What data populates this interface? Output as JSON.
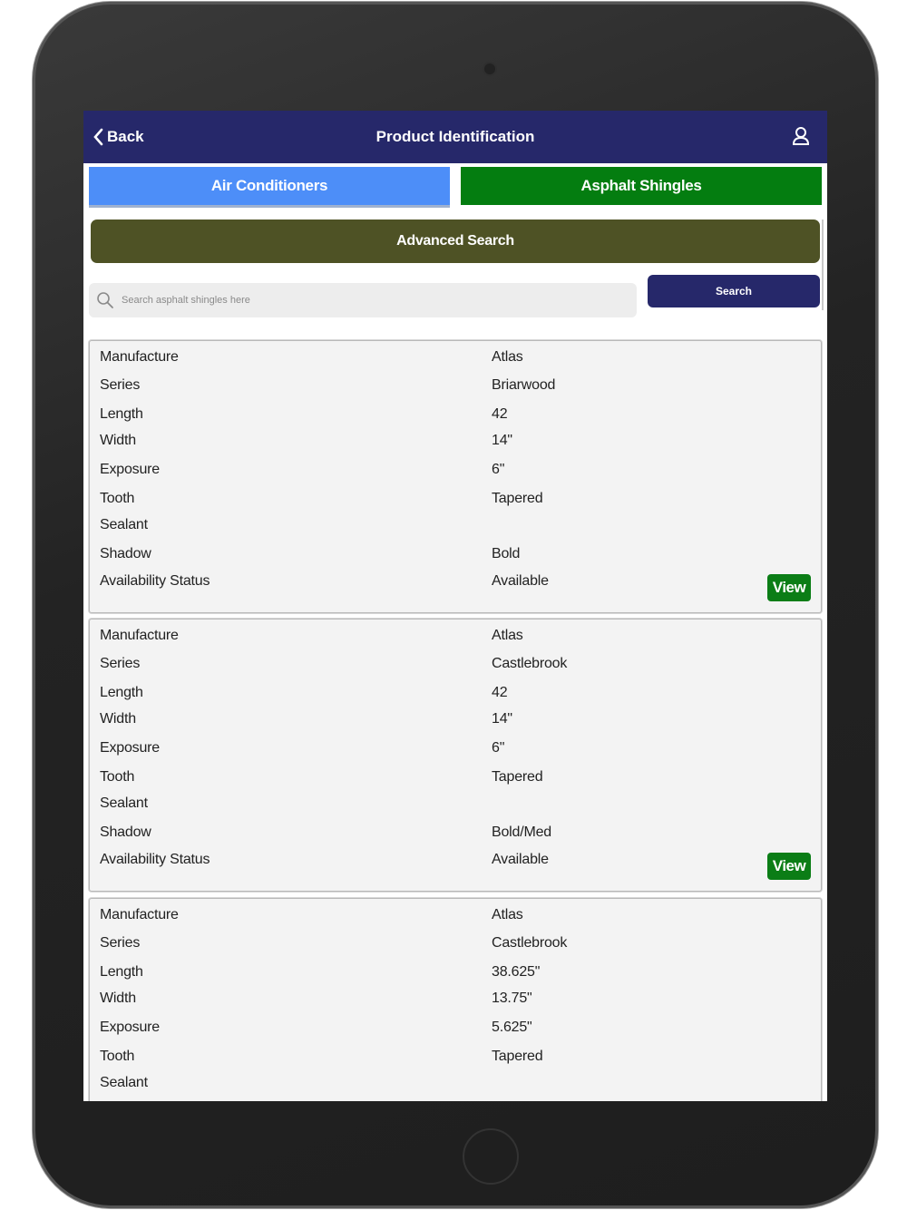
{
  "header": {
    "back_label": "Back",
    "title": "Product Identification",
    "back_icon": "chevron-left-icon",
    "user_icon": "user-icon"
  },
  "tabs": [
    {
      "label": "Air Conditioners",
      "color": "#4d8ef8"
    },
    {
      "label": "Asphalt Shingles",
      "color": "#047d10"
    }
  ],
  "advanced_search_label": "Advanced Search",
  "search": {
    "placeholder": "Search asphalt shingles here",
    "button_label": "Search",
    "icon": "search-icon"
  },
  "field_labels": [
    "Manufacture",
    "Series",
    "Length",
    "Width",
    "Exposure",
    "Tooth",
    "Sealant",
    "Shadow",
    "Availability Status"
  ],
  "view_label": "View",
  "results": [
    {
      "values": [
        "Atlas",
        "Briarwood",
        "42",
        "14\"",
        "6\"",
        "Tapered",
        "",
        "Bold",
        "Available"
      ]
    },
    {
      "values": [
        "Atlas",
        "Castlebrook",
        "42",
        "14\"",
        "6\"",
        "Tapered",
        "",
        "Bold/Med",
        "Available"
      ]
    },
    {
      "values": [
        "Atlas",
        "Castlebrook",
        "38.625\"",
        "13.75\"",
        "5.625\"",
        "Tapered",
        "",
        "",
        ""
      ]
    }
  ],
  "colors": {
    "header_bg": "#26286a",
    "advanced_search_bg": "#4e5225",
    "view_button_bg": "#0b7d16"
  }
}
